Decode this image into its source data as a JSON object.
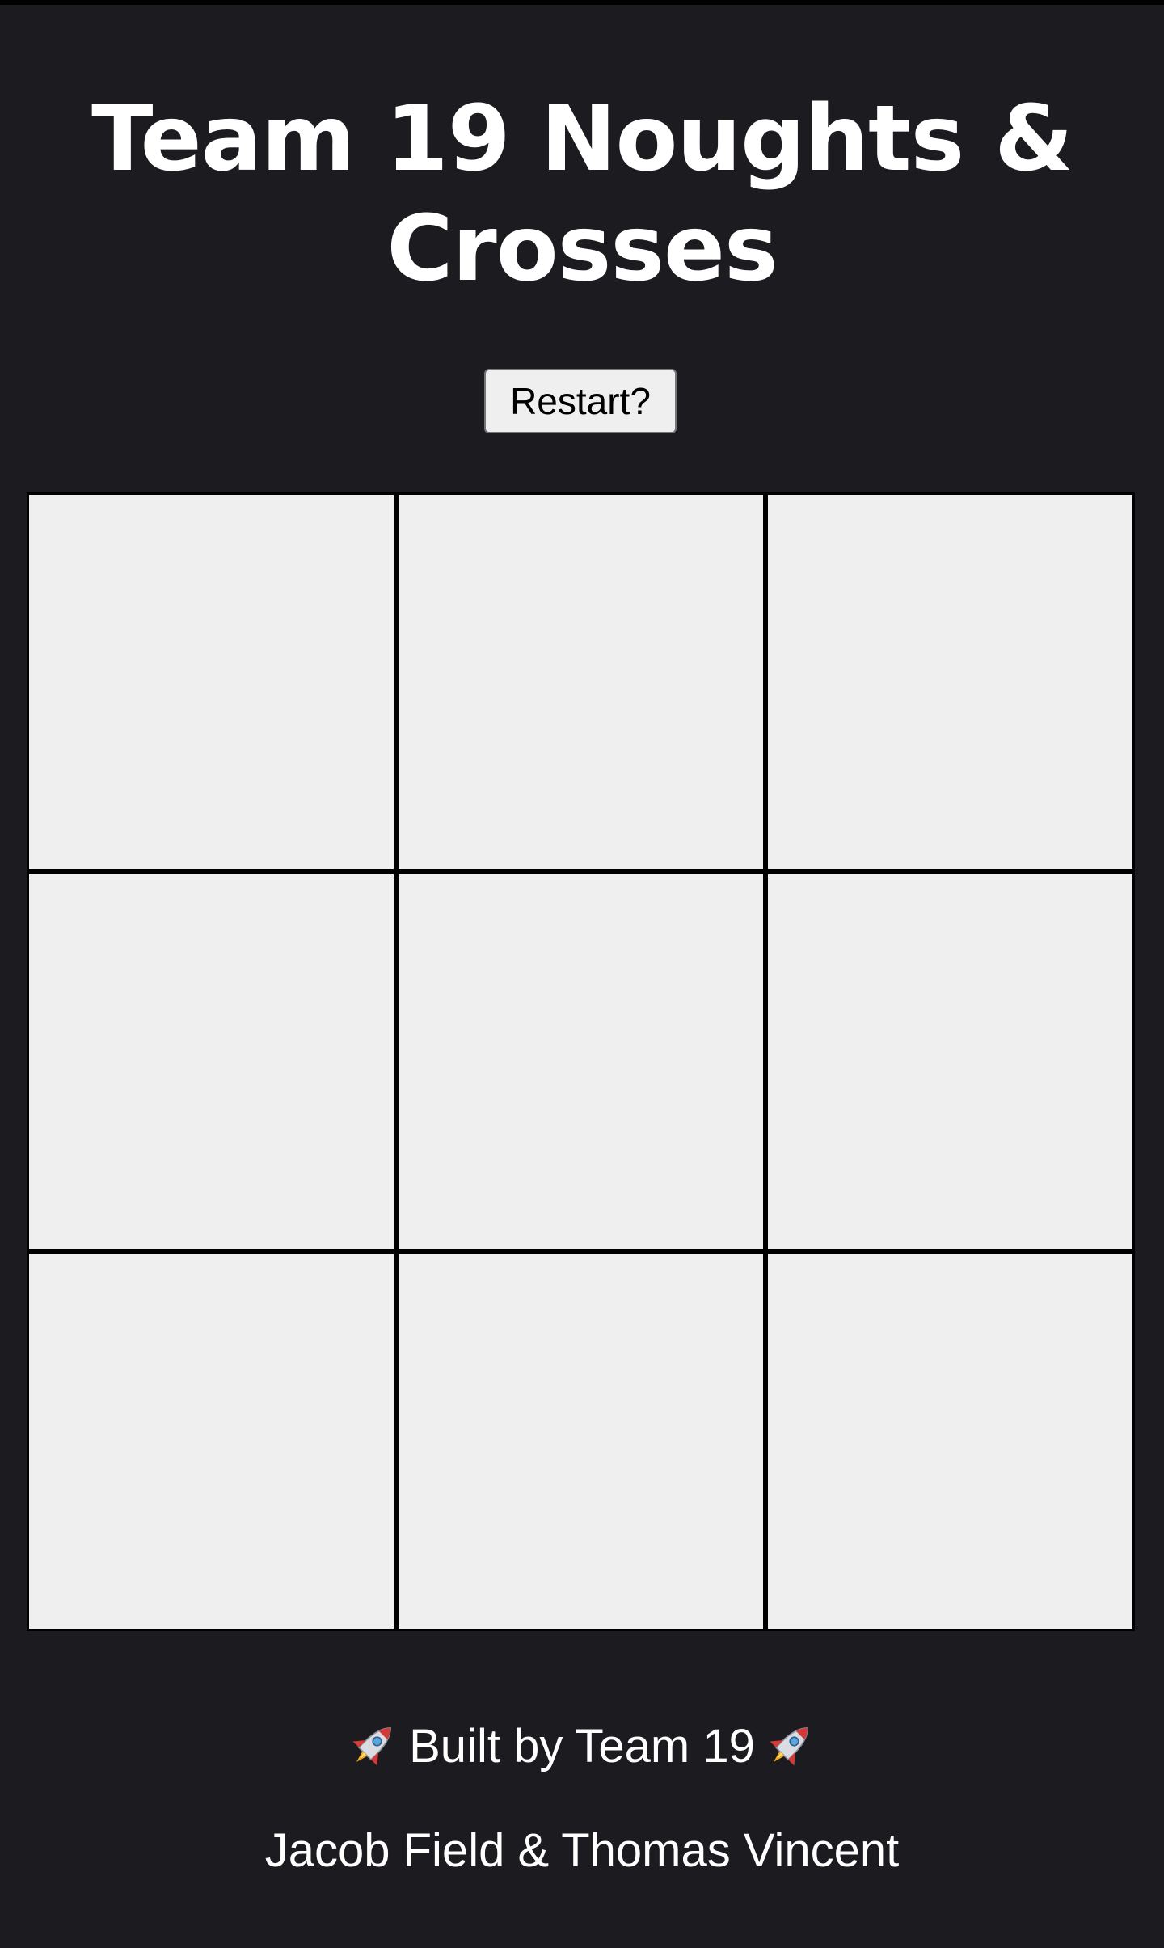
{
  "header": {
    "title": "Team 19 Noughts & Crosses",
    "restart_label": "Restart?"
  },
  "board": {
    "cells": [
      "",
      "",
      "",
      "",
      "",
      "",
      "",
      "",
      ""
    ]
  },
  "footer": {
    "built_by": "Built by Team 19",
    "left_icon": "rocket-icon",
    "right_icon": "rocket-icon",
    "authors": "Jacob Field & Thomas Vincent"
  },
  "colors": {
    "background": "#1b1b20",
    "cell": "#efefef",
    "grid_lines": "#000000",
    "text": "#ffffff"
  }
}
